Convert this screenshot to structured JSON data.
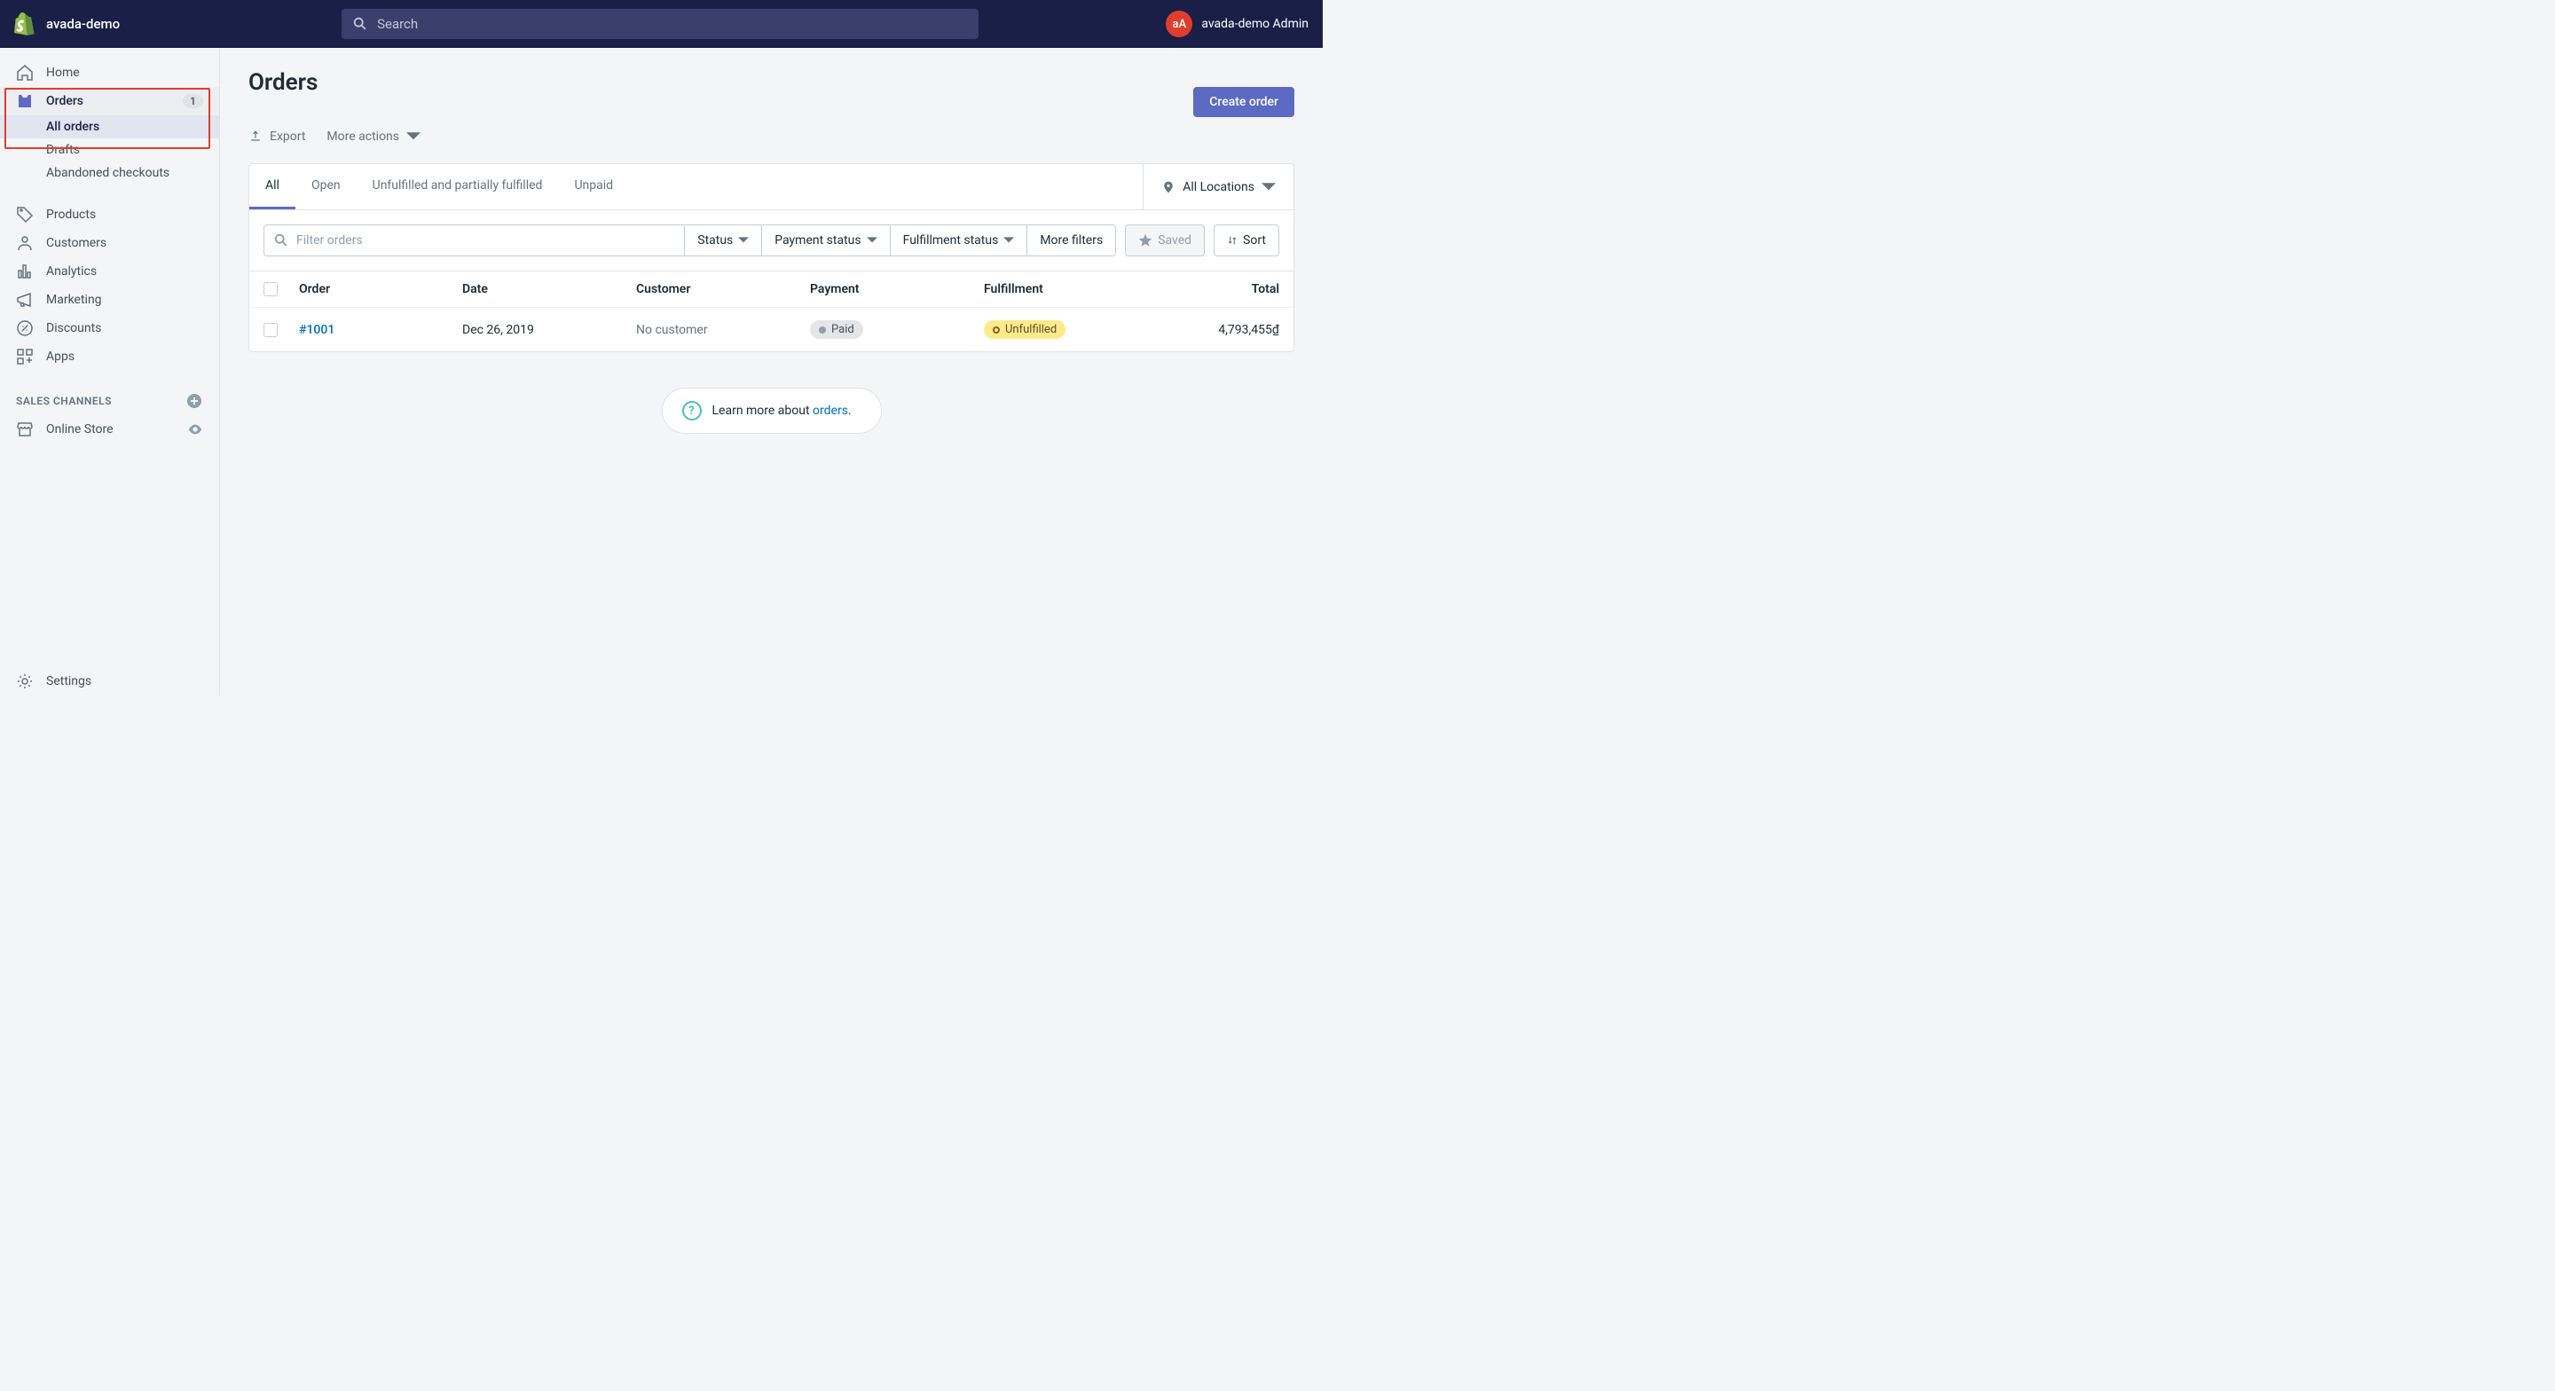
{
  "topbar": {
    "store_name": "avada-demo",
    "search_placeholder": "Search",
    "avatar_initials": "aA",
    "admin_name": "avada-demo Admin"
  },
  "sidebar": {
    "items": [
      {
        "label": "Home"
      },
      {
        "label": "Orders",
        "badge": "1"
      },
      {
        "label": "Products"
      },
      {
        "label": "Customers"
      },
      {
        "label": "Analytics"
      },
      {
        "label": "Marketing"
      },
      {
        "label": "Discounts"
      },
      {
        "label": "Apps"
      }
    ],
    "orders_sub": [
      {
        "label": "All orders"
      },
      {
        "label": "Drafts"
      },
      {
        "label": "Abandoned checkouts"
      }
    ],
    "channels_heading": "SALES CHANNELS",
    "online_store": "Online Store",
    "settings": "Settings"
  },
  "page": {
    "title": "Orders",
    "create_button": "Create order",
    "export": "Export",
    "more_actions": "More actions"
  },
  "tabs": [
    {
      "label": "All"
    },
    {
      "label": "Open"
    },
    {
      "label": "Unfulfilled and partially fulfilled"
    },
    {
      "label": "Unpaid"
    }
  ],
  "location_label": "All Locations",
  "filters": {
    "input_placeholder": "Filter orders",
    "status": "Status",
    "payment_status": "Payment status",
    "fulfillment_status": "Fulfillment status",
    "more_filters": "More filters",
    "saved": "Saved",
    "sort": "Sort"
  },
  "table": {
    "headers": {
      "order": "Order",
      "date": "Date",
      "customer": "Customer",
      "payment": "Payment",
      "fulfillment": "Fulfillment",
      "total": "Total"
    },
    "rows": [
      {
        "order": "#1001",
        "date": "Dec 26, 2019",
        "customer": "No customer",
        "payment": "Paid",
        "fulfillment": "Unfulfilled",
        "total": "4,793,455₫"
      }
    ]
  },
  "learn_more": {
    "prefix": "Learn more about ",
    "link": "orders",
    "suffix": "."
  }
}
